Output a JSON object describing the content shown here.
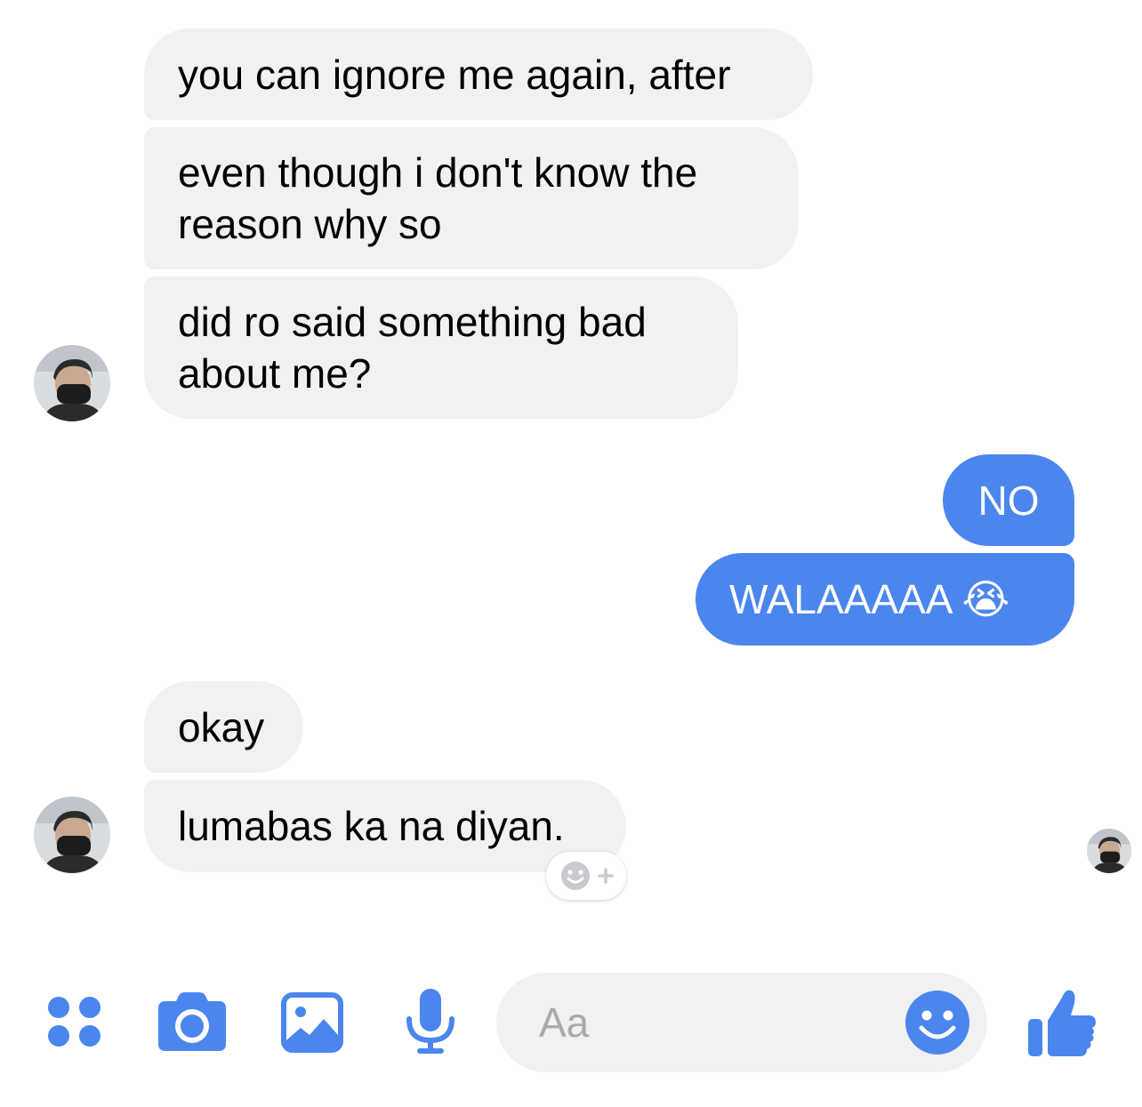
{
  "thread": {
    "messages": [
      {
        "sender": "contact",
        "text": "you can ignore me again, after"
      },
      {
        "sender": "contact",
        "text": "even though i don't know the\nreason why so"
      },
      {
        "sender": "contact",
        "text": "did ro said something bad\nabout me?"
      },
      {
        "sender": "me",
        "text": "NO"
      },
      {
        "sender": "me",
        "text": "WALAAAAA 😭"
      },
      {
        "sender": "contact",
        "text": "okay"
      },
      {
        "sender": "contact",
        "text": "lumabas ka na diyan."
      }
    ]
  },
  "composer": {
    "placeholder": "Aa"
  },
  "icons": {
    "apps": "apps-grid-icon",
    "camera": "camera-icon",
    "gallery": "gallery-icon",
    "mic": "microphone-icon",
    "emoji": "emoji-icon",
    "like": "thumbs-up-icon",
    "react": "add-reaction-icon"
  },
  "colors": {
    "accent": "#4b86ee",
    "incoming_bubble": "#f1f1f2",
    "outgoing_text": "#ffffff",
    "placeholder": "#a7a9ad"
  }
}
